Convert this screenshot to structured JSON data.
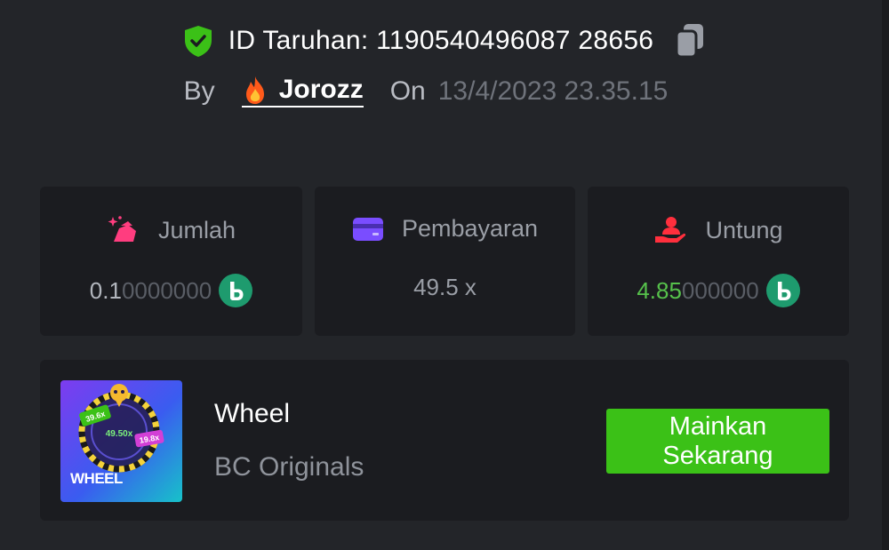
{
  "bet": {
    "id_label": "ID Taruhan: 1190540496087 28656",
    "by_label": "By",
    "username": "Jorozz",
    "on_label": "On",
    "date": "13/4/2023 23.35.15"
  },
  "stats": {
    "amount": {
      "label": "Jumlah",
      "value_lead": "0.1",
      "value_rest": "0000000"
    },
    "payout": {
      "label": "Pembayaran",
      "value": "49.5 x"
    },
    "profit": {
      "label": "Untung",
      "value_lead": "4.85",
      "value_rest": "000000"
    }
  },
  "game": {
    "thumb_label": "WHEEL",
    "thumb_texts": [
      "39.6x",
      "49.50x",
      "19.8x"
    ],
    "name": "Wheel",
    "provider": "BC Originals",
    "play_button": "Mainkan Sekarang"
  },
  "colors": {
    "background": "#232529",
    "card": "#1b1c20",
    "accent_green": "#3bc117",
    "profit_green": "#56c14b",
    "coin": "#1e9b6e"
  },
  "icons": {
    "verified": "shield-check-icon",
    "copy": "copy-icon",
    "user_badge": "fire-icon",
    "amount": "bag-sparkle-icon",
    "payout": "card-icon",
    "profit": "hand-user-icon",
    "currency": "bc-coin-icon"
  }
}
